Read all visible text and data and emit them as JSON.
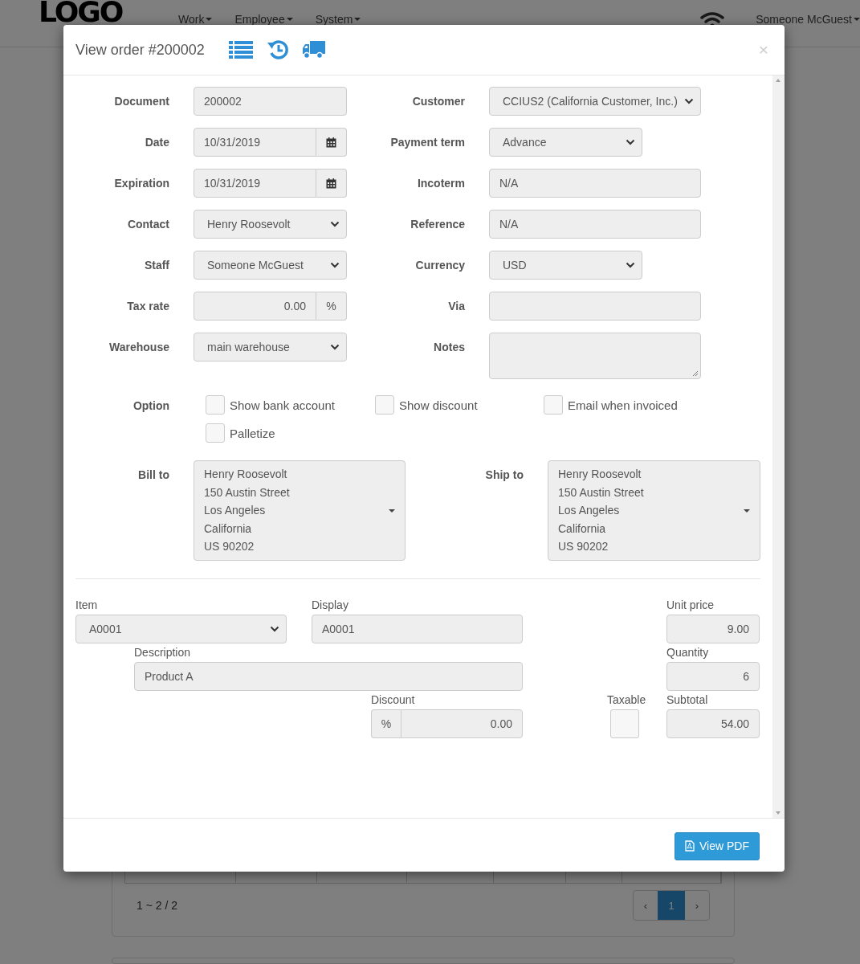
{
  "navbar": {
    "logo": "LOGO",
    "menus": [
      {
        "label": "Work"
      },
      {
        "label": "Employee"
      },
      {
        "label": "System"
      }
    ],
    "user": "Someone McGuest"
  },
  "background": {
    "pagination_summary": "1 ~ 2 / 2",
    "pagination": [
      {
        "label": "‹",
        "selected": false
      },
      {
        "label": "1",
        "selected": true
      },
      {
        "label": "›",
        "selected": false
      }
    ]
  },
  "modal": {
    "title": "View order #200002",
    "close": "×",
    "form_rows": [
      [
        {
          "label": "Document",
          "kind": "text",
          "value": "200002"
        },
        {
          "label": "Customer",
          "kind": "select",
          "value": "CCIUS2 (California Customer, Inc.)",
          "wide": true
        }
      ],
      [
        {
          "label": "Date",
          "kind": "date",
          "value": "10/31/2019"
        },
        {
          "label": "Payment term",
          "kind": "select",
          "value": "Advance",
          "wide": false
        }
      ],
      [
        {
          "label": "Expiration",
          "kind": "date",
          "value": "10/31/2019"
        },
        {
          "label": "Incoterm",
          "kind": "text",
          "value": "N/A",
          "wide": true
        }
      ],
      [
        {
          "label": "Contact",
          "kind": "select",
          "value": "Henry Roosevolt"
        },
        {
          "label": "Reference",
          "kind": "text",
          "value": "N/A",
          "wide": true
        }
      ],
      [
        {
          "label": "Staff",
          "kind": "select",
          "value": "Someone McGuest"
        },
        {
          "label": "Currency",
          "kind": "select",
          "value": "USD",
          "wide": false
        }
      ],
      [
        {
          "label": "Tax rate",
          "kind": "percent",
          "value": "0.00",
          "unit": "%"
        },
        {
          "label": "Via",
          "kind": "text",
          "wide": true
        }
      ],
      [
        {
          "label": "Warehouse",
          "kind": "select",
          "value": "main warehouse"
        },
        {
          "label": "Notes",
          "kind": "textarea",
          "wide": true
        }
      ]
    ],
    "options_label": "Option",
    "options": [
      {
        "label": "Show bank account",
        "checked": false
      },
      {
        "label": "Show discount",
        "checked": false
      },
      {
        "label": "Email when invoiced",
        "checked": false
      },
      {
        "label": "Palletize",
        "checked": false
      }
    ],
    "addresses": [
      {
        "label": "Bill to",
        "lines": [
          "Henry Roosevolt",
          "150 Austin Street",
          "Los Angeles",
          "California",
          "US 90202"
        ]
      },
      {
        "label": "Ship to",
        "lines": [
          "Henry Roosevolt",
          "150 Austin Street",
          "Los Angeles",
          "California",
          "US 90202"
        ]
      }
    ],
    "line_item": [
      {
        "label": "Item",
        "kind": "select",
        "value": "A0001"
      },
      {
        "label": "Display",
        "kind": "text",
        "value": "A0001"
      },
      {
        "label": "Unit price",
        "kind": "number",
        "value": "9.00"
      },
      {
        "label": "Description",
        "kind": "text",
        "value": "Product A"
      },
      {
        "label": "Quantity",
        "kind": "number",
        "value": "6"
      },
      {
        "label": "Discount",
        "kind": "percent",
        "value": "0.00",
        "unit": "%"
      },
      {
        "label": "Taxable",
        "kind": "checkbox",
        "checked": false
      },
      {
        "label": "Subtotal",
        "kind": "number",
        "value": "54.00"
      }
    ],
    "footer_button": "View PDF"
  }
}
